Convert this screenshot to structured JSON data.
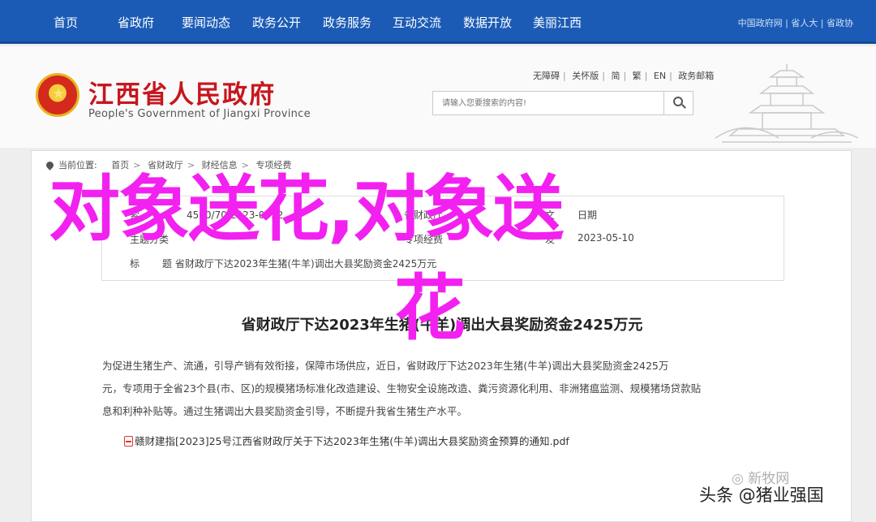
{
  "nav": {
    "items": [
      "首页",
      "省政府",
      "要闻动态",
      "政务公开",
      "政务服务",
      "互动交流",
      "数据开放",
      "美丽江西"
    ],
    "gov_links": [
      "中国政府网",
      "省人大",
      "省政协"
    ]
  },
  "header": {
    "title": "江西省人民政府",
    "subtitle": "People's Government of Jiangxi Province",
    "util_links": [
      "无障碍",
      "关怀版",
      "简",
      "繁",
      "EN",
      "政务邮箱"
    ],
    "search_placeholder": "请输入您要搜索的内容!"
  },
  "breadcrumb": {
    "label": "当前位置:",
    "items": [
      "首页",
      "省财政厅",
      "财经信息",
      "专项经费"
    ]
  },
  "info": {
    "row1": {
      "label": "索",
      "value": "4500/70/2023-0032",
      "right": "省财政厅"
    },
    "row2": {
      "label": "主题分类",
      "value": "",
      "right": "专项经费"
    },
    "row3": {
      "label": "标",
      "value": "题 省财政厅下达2023年生猪(牛羊)调出大县奖励资金2425万元"
    },
    "side_labels": [
      "文",
      "发"
    ],
    "side_values": [
      "日期",
      "2023-05-10"
    ]
  },
  "article": {
    "title": "省财政厅下达2023年生猪(牛羊)调出大县奖励资金2425万元",
    "para1": "为促进生猪生产、流通，引导产销有效衔接，保障市场供应，近日，省财政厅下达2023年生猪(牛羊)调出大县奖励资金2425万",
    "para2": "元，专项用于全省23个县(市、区)的规模猪场标准化改造建设、生物安全设施改造、粪污资源化利用、非洲猪瘟监测、规模猪场贷款贴",
    "para3": "息和利种补贴等。通过生猪调出大县奖励资金引导，不断提升我省生猪生产水平。",
    "attachment": "赣财建指[2023]25号江西省财政厅关于下达2023年生猪(牛羊)调出大县奖励资金预算的通知.pdf"
  },
  "overlay": {
    "line1": "对象送花,对象送",
    "line2": "花"
  },
  "watermarks": {
    "wechat": "新牧网",
    "toutiao": "头条 @猪业强国"
  },
  "colors": {
    "nav_bg": "#1b5bb5",
    "title_red": "#c7161e",
    "overlay_magenta": "#f221f0"
  }
}
